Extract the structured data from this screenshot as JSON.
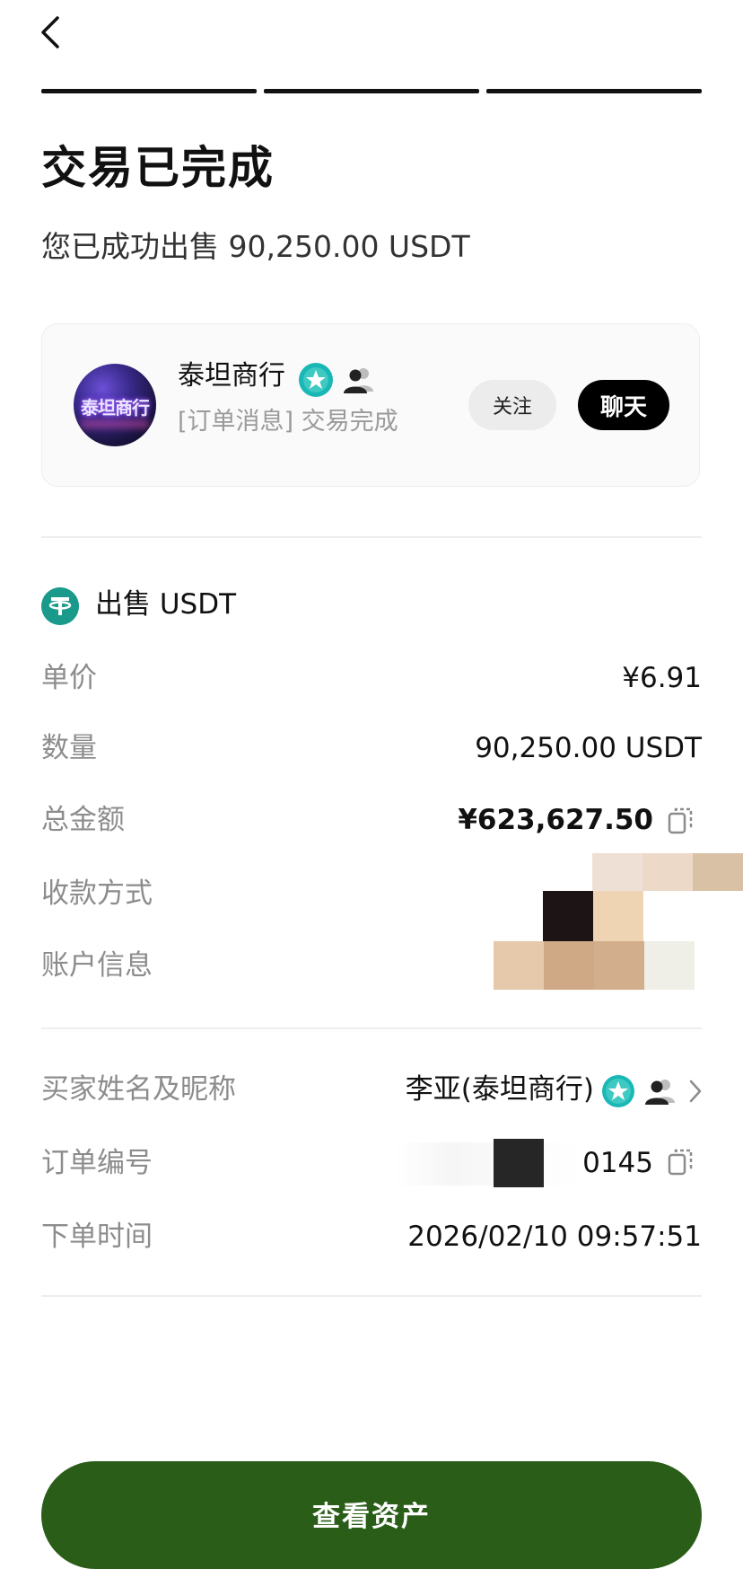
{
  "header": {
    "back_icon": "chevron-left-icon",
    "progress_steps": 3
  },
  "status": {
    "title": "交易已完成",
    "subtitle": "您已成功出售 90,250.00 USDT"
  },
  "merchant": {
    "name": "泰坦商行",
    "avatar_text": "泰坦商行",
    "message": "[订单消息] 交易完成",
    "follow_label": "关注",
    "chat_label": "聊天",
    "badges": [
      "verified-star-icon",
      "people-icon"
    ]
  },
  "trade": {
    "heading": "出售 USDT",
    "coin_icon": "usdt-icon",
    "rows": [
      {
        "label": "单价",
        "value": "¥6.91"
      },
      {
        "label": "数量",
        "value": "90,250.00 USDT"
      },
      {
        "label": "总金额",
        "value": "¥623,627.50"
      },
      {
        "label": "收款方式",
        "value": ""
      },
      {
        "label": "账户信息",
        "value": ""
      }
    ]
  },
  "details": {
    "buyer_label": "买家姓名及昵称",
    "buyer_value": "李亚(泰坦商行)",
    "order_label": "订单编号",
    "order_value": "0145",
    "time_label": "下单时间",
    "time_value": "2026/02/10 09:57:51"
  },
  "cta": {
    "label": "查看资产"
  },
  "colors": {
    "accent_green": "#2a5e18",
    "usdt_teal": "#1a9a8b",
    "badge_teal": "#19b7b5"
  }
}
